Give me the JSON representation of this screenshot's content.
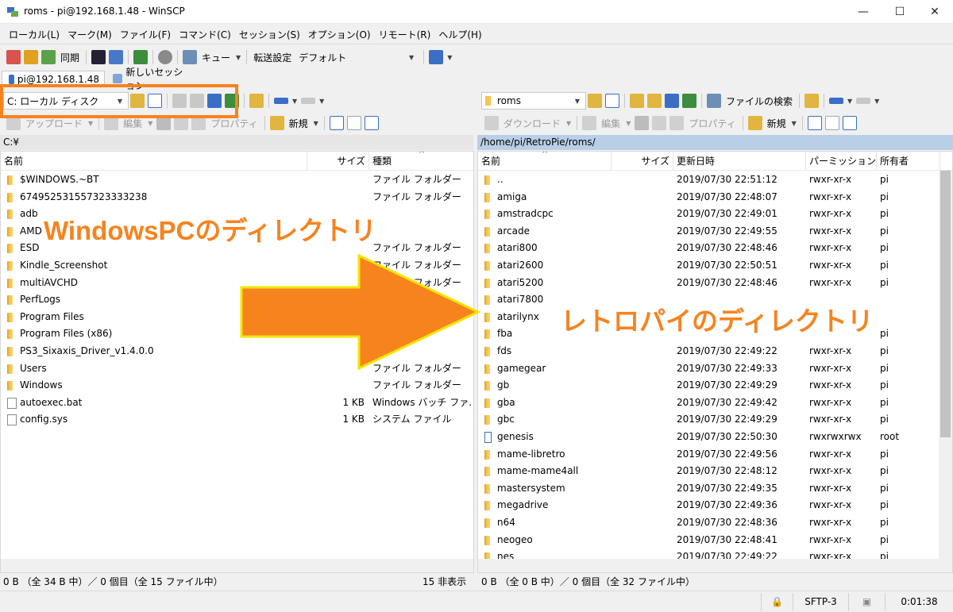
{
  "window": {
    "title": "roms - pi@192.168.1.48 - WinSCP",
    "min": "—",
    "max": "☐",
    "close": "✕"
  },
  "menu": [
    "ローカル(L)",
    "マーク(M)",
    "ファイル(F)",
    "コマンド(C)",
    "セッション(S)",
    "オプション(O)",
    "リモート(R)",
    "ヘルプ(H)"
  ],
  "toolbar": {
    "sync_label": "同期",
    "queue_label": "キュー",
    "transfer_label": "転送設定",
    "transfer_value": "デフォルト"
  },
  "tabs": {
    "session": "pi@192.168.1.48",
    "new_session": "新しいセッション"
  },
  "left": {
    "drive": "C: ローカル ディスク",
    "upload": "アップロード",
    "edit": "編集",
    "properties": "プロパティ",
    "new": "新規",
    "path": "C:¥",
    "columns": {
      "name": "名前",
      "size": "サイズ",
      "type": "種類"
    },
    "rows": [
      {
        "name": "$WINDOWS.~BT",
        "size": "",
        "type": "ファイル フォルダー",
        "kind": "folder"
      },
      {
        "name": "674952531557323333238",
        "size": "",
        "type": "ファイル フォルダー",
        "kind": "folder"
      },
      {
        "name": "adb",
        "size": "",
        "type": "",
        "kind": "folder"
      },
      {
        "name": "AMD",
        "size": "",
        "type": "",
        "kind": "folder"
      },
      {
        "name": "ESD",
        "size": "",
        "type": "ファイル フォルダー",
        "kind": "folder"
      },
      {
        "name": "Kindle_Screenshot",
        "size": "",
        "type": "ファイル フォルダー",
        "kind": "folder"
      },
      {
        "name": "multiAVCHD",
        "size": "",
        "type": "ファイル フォルダー",
        "kind": "folder"
      },
      {
        "name": "PerfLogs",
        "size": "",
        "type": "",
        "kind": "folder"
      },
      {
        "name": "Program Files",
        "size": "",
        "type": "",
        "kind": "folder"
      },
      {
        "name": "Program Files (x86)",
        "size": "",
        "type": "",
        "kind": "folder"
      },
      {
        "name": "PS3_Sixaxis_Driver_v1.4.0.0",
        "size": "",
        "type": "",
        "kind": "folder"
      },
      {
        "name": "Users",
        "size": "",
        "type": "ファイル フォルダー",
        "kind": "folder"
      },
      {
        "name": "Windows",
        "size": "",
        "type": "ファイル フォルダー",
        "kind": "folder"
      },
      {
        "name": "autoexec.bat",
        "size": "1 KB",
        "type": "Windows バッチ ファ...",
        "kind": "file"
      },
      {
        "name": "config.sys",
        "size": "1 KB",
        "type": "システム ファイル",
        "kind": "file"
      }
    ],
    "status": "0 B （全 34 B 中）／ 0 個目（全 15 ファイル中）",
    "hidden": "15 非表示"
  },
  "right": {
    "folder": "roms",
    "download": "ダウンロード",
    "edit": "編集",
    "properties": "プロパティ",
    "new": "新規",
    "find": "ファイルの検索",
    "path": "/home/pi/RetroPie/roms/",
    "columns": {
      "name": "名前",
      "size": "サイズ",
      "modified": "更新日時",
      "perm": "パーミッション",
      "owner": "所有者"
    },
    "rows": [
      {
        "name": "..",
        "modified": "2019/07/30 22:51:12",
        "perm": "rwxr-xr-x",
        "owner": "pi",
        "kind": "up"
      },
      {
        "name": "amiga",
        "modified": "2019/07/30 22:48:07",
        "perm": "rwxr-xr-x",
        "owner": "pi",
        "kind": "folder"
      },
      {
        "name": "amstradcpc",
        "modified": "2019/07/30 22:49:01",
        "perm": "rwxr-xr-x",
        "owner": "pi",
        "kind": "folder"
      },
      {
        "name": "arcade",
        "modified": "2019/07/30 22:49:55",
        "perm": "rwxr-xr-x",
        "owner": "pi",
        "kind": "folder"
      },
      {
        "name": "atari800",
        "modified": "2019/07/30 22:48:46",
        "perm": "rwxr-xr-x",
        "owner": "pi",
        "kind": "folder"
      },
      {
        "name": "atari2600",
        "modified": "2019/07/30 22:50:51",
        "perm": "rwxr-xr-x",
        "owner": "pi",
        "kind": "folder"
      },
      {
        "name": "atari5200",
        "modified": "2019/07/30 22:48:46",
        "perm": "rwxr-xr-x",
        "owner": "pi",
        "kind": "folder"
      },
      {
        "name": "atari7800",
        "modified": "",
        "perm": "",
        "owner": "",
        "kind": "folder"
      },
      {
        "name": "atarilynx",
        "modified": "",
        "perm": "",
        "owner": "",
        "kind": "folder"
      },
      {
        "name": "fba",
        "modified": "",
        "perm": "",
        "owner": "pi",
        "kind": "folder"
      },
      {
        "name": "fds",
        "modified": "2019/07/30 22:49:22",
        "perm": "rwxr-xr-x",
        "owner": "pi",
        "kind": "folder"
      },
      {
        "name": "gamegear",
        "modified": "2019/07/30 22:49:33",
        "perm": "rwxr-xr-x",
        "owner": "pi",
        "kind": "folder"
      },
      {
        "name": "gb",
        "modified": "2019/07/30 22:49:29",
        "perm": "rwxr-xr-x",
        "owner": "pi",
        "kind": "folder"
      },
      {
        "name": "gba",
        "modified": "2019/07/30 22:49:42",
        "perm": "rwxr-xr-x",
        "owner": "pi",
        "kind": "folder"
      },
      {
        "name": "gbc",
        "modified": "2019/07/30 22:49:29",
        "perm": "rwxr-xr-x",
        "owner": "pi",
        "kind": "folder"
      },
      {
        "name": "genesis",
        "modified": "2019/07/30 22:50:30",
        "perm": "rwxrwxrwx",
        "owner": "root",
        "kind": "link"
      },
      {
        "name": "mame-libretro",
        "modified": "2019/07/30 22:49:56",
        "perm": "rwxr-xr-x",
        "owner": "pi",
        "kind": "folder"
      },
      {
        "name": "mame-mame4all",
        "modified": "2019/07/30 22:48:12",
        "perm": "rwxr-xr-x",
        "owner": "pi",
        "kind": "folder"
      },
      {
        "name": "mastersystem",
        "modified": "2019/07/30 22:49:35",
        "perm": "rwxr-xr-x",
        "owner": "pi",
        "kind": "folder"
      },
      {
        "name": "megadrive",
        "modified": "2019/07/30 22:49:36",
        "perm": "rwxr-xr-x",
        "owner": "pi",
        "kind": "folder"
      },
      {
        "name": "n64",
        "modified": "2019/07/30 22:48:36",
        "perm": "rwxr-xr-x",
        "owner": "pi",
        "kind": "folder"
      },
      {
        "name": "neogeo",
        "modified": "2019/07/30 22:48:41",
        "perm": "rwxr-xr-x",
        "owner": "pi",
        "kind": "folder"
      },
      {
        "name": "nes",
        "modified": "2019/07/30 22:49:22",
        "perm": "rwxr-xr-x",
        "owner": "pi",
        "kind": "folder"
      }
    ],
    "status": "0 B （全 0 B 中）／ 0 個目（全 32 ファイル中）"
  },
  "statusbar": {
    "protocol": "SFTP-3",
    "time": "0:01:38"
  },
  "annotations": {
    "left_label": "WindowsPCのディレクトリ",
    "right_label": "レトロパイのディレクトリ"
  },
  "colors": {
    "accent": "#f7831e",
    "arrow_border": "#f5e400",
    "path_bar": "#b9cfe8"
  }
}
